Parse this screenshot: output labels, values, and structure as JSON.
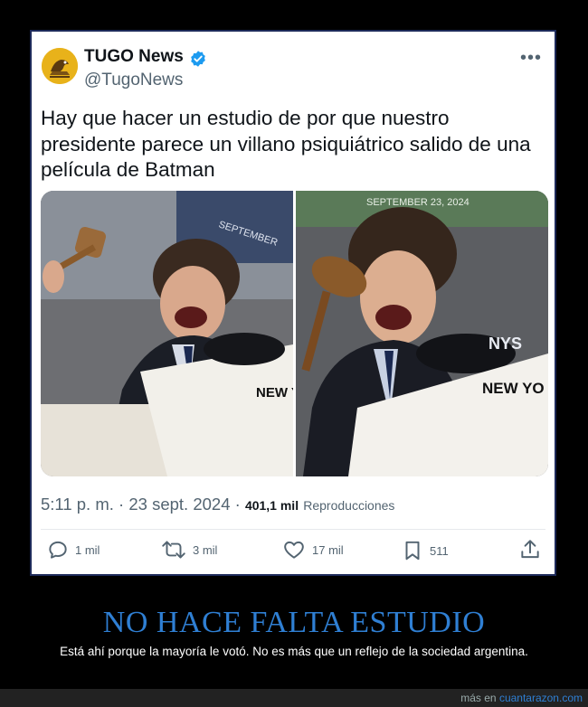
{
  "tweet": {
    "author_name": "TUGO News",
    "handle": "@TugoNews",
    "avatar_icon": "tugo-news-logo",
    "verified_icon": "verified-badge-icon",
    "text": "Hay que hacer un estudio de por que nuestro presidente parece un villano psiquiátrico salido de una película de Batman",
    "media": [
      {
        "description_icon": "photo-man-with-gavel-left"
      },
      {
        "description_icon": "photo-man-with-gavel-right"
      }
    ],
    "time": "5:11 p. m.",
    "sep": "·",
    "date": "23 sept. 2024",
    "views_count": "401,1 mil",
    "views_label": "Reproducciones",
    "actions": {
      "replies": "1 mil",
      "retweets": "3 mil",
      "likes": "17 mil",
      "bookmarks": "511"
    }
  },
  "caption": {
    "title": "NO HACE FALTA ESTUDIO",
    "subtitle": "Está ahí porque la mayoría le votó. No es más que un reflejo de la sociedad argentina."
  },
  "footer": {
    "prefix": "más en",
    "site": "cuantarazon.com"
  },
  "colors": {
    "accent": "#2f7fd3",
    "verified": "#1d9bf0",
    "text": "#0f1419",
    "muted": "#536471"
  }
}
